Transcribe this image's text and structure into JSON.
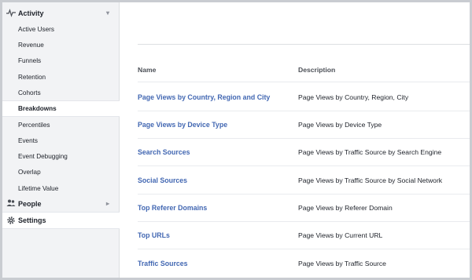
{
  "sidebar": {
    "activity": {
      "label": "Activity",
      "icon": "activity-pulse-icon",
      "caret": "▾"
    },
    "items": [
      {
        "label": "Active Users"
      },
      {
        "label": "Revenue"
      },
      {
        "label": "Funnels"
      },
      {
        "label": "Retention"
      },
      {
        "label": "Cohorts"
      },
      {
        "label": "Breakdowns",
        "active": true
      },
      {
        "label": "Percentiles"
      },
      {
        "label": "Events"
      },
      {
        "label": "Event Debugging"
      },
      {
        "label": "Overlap"
      },
      {
        "label": "Lifetime Value"
      }
    ],
    "people": {
      "label": "People",
      "icon": "people-icon",
      "caret": "▸"
    },
    "settings": {
      "label": "Settings",
      "icon": "gear-icon"
    }
  },
  "table": {
    "headers": {
      "name": "Name",
      "description": "Description"
    },
    "rows": [
      {
        "name": "Page Views by Country, Region and City",
        "description": "Page Views by Country, Region, City"
      },
      {
        "name": "Page Views by Device Type",
        "description": "Page Views by Device Type"
      },
      {
        "name": "Search Sources",
        "description": "Page Views by Traffic Source by Search Engine"
      },
      {
        "name": "Social Sources",
        "description": "Page Views by Traffic Source by Social Network"
      },
      {
        "name": "Top Referer Domains",
        "description": "Page Views by Referer Domain"
      },
      {
        "name": "Top URLs",
        "description": "Page Views by Current URL"
      },
      {
        "name": "Traffic Sources",
        "description": "Page Views by Traffic Source"
      }
    ]
  },
  "colors": {
    "link": "#4267b2",
    "sidebar_bg": "#f2f3f5",
    "border": "#dddfe2"
  }
}
